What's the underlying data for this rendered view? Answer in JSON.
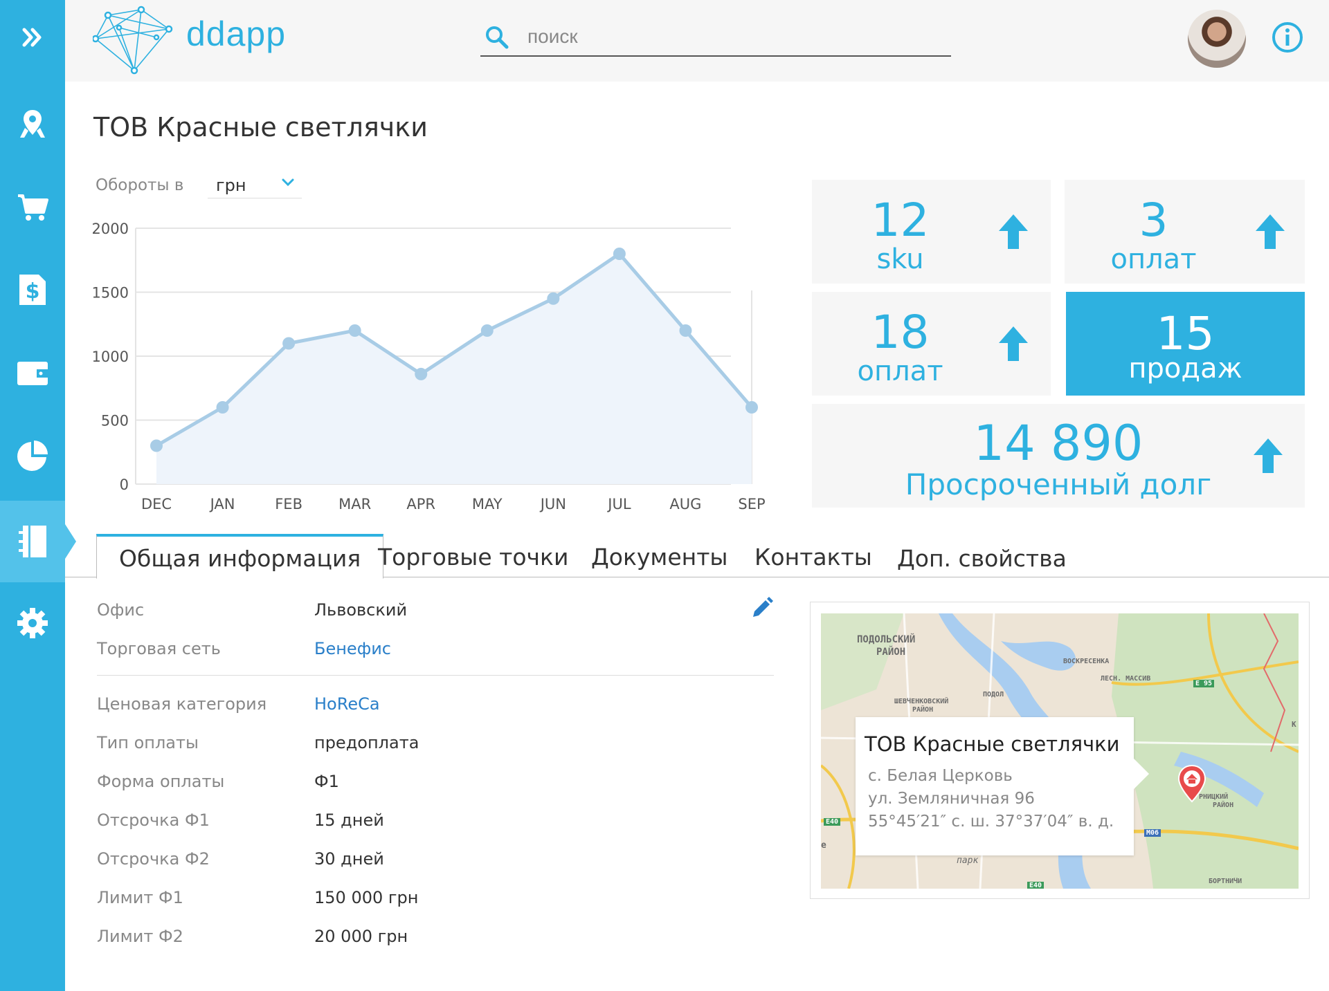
{
  "app": {
    "logo_text": "ddapp"
  },
  "search": {
    "placeholder": "поиск"
  },
  "sidebar": {
    "items": [
      "expand-icon",
      "map-pin-icon",
      "cart-icon",
      "invoice-dollar-icon",
      "wallet-icon",
      "pie-chart-icon",
      "contact-book-icon",
      "gear-icon"
    ],
    "active_index": 6
  },
  "page": {
    "title": "ТОВ Красные светлячки"
  },
  "turnover": {
    "label": "Обороты в",
    "currency": "грн"
  },
  "chart_data": {
    "type": "area",
    "categories": [
      "DEC",
      "JAN",
      "FEB",
      "MAR",
      "APR",
      "MAY",
      "JUN",
      "JUL",
      "AUG",
      "SEP"
    ],
    "values": [
      300,
      600,
      1100,
      1200,
      860,
      1200,
      1450,
      1800,
      1200,
      600
    ],
    "yticks": [
      "0",
      "500",
      "1000",
      "1500",
      "2000"
    ],
    "ylim": [
      0,
      2000
    ],
    "line_color": "#a8cce6",
    "fill_color": "#eef4fb"
  },
  "kpis": {
    "sku": {
      "value": "12",
      "label": "sku"
    },
    "payments_a": {
      "value": "3",
      "label": "оплат"
    },
    "payments_b": {
      "value": "18",
      "label": "оплат"
    },
    "sales": {
      "value": "15",
      "label": "продаж"
    },
    "debt": {
      "value": "14 890",
      "label": "Просроченный долг"
    }
  },
  "tabs": [
    "Общая информация",
    "Торговые точки",
    "Документы",
    "Контакты",
    "Доп. свойства"
  ],
  "details": [
    {
      "key": "Офис",
      "value": "Львовский"
    },
    {
      "key": "Торговая сеть",
      "value": "Бенефис"
    },
    {
      "key": "Ценовая категория",
      "value": "HoReCa"
    },
    {
      "key": "Тип оплаты",
      "value": "предоплата"
    },
    {
      "key": "Форма оплаты",
      "value": "Ф1"
    },
    {
      "key": "Отсрочка Ф1",
      "value": "15 дней"
    },
    {
      "key": "Отсрочка Ф2",
      "value": "30 дней"
    },
    {
      "key": "Лимит Ф1",
      "value": "150 000 грн"
    },
    {
      "key": "Лимит Ф2",
      "value": "20 000 грн"
    }
  ],
  "map": {
    "popup": {
      "title": "ТОВ Красные светлячки",
      "line1": "с. Белая Церковь",
      "line2": "ул. Земляничная 96",
      "line3": "55°45′21″ с. ш. 37°37′04″ в. д."
    },
    "labels": {
      "podolsky": "ПОДОЛЬСКИЙ",
      "rayon": "РАЙОН",
      "voskresenka": "ВОСКРЕСЕНКА",
      "les_massiv": "ЛЕСН. МАССИВ",
      "shevchenkovsky": "ШЕВЧЕНКОВСКИЙ",
      "rayon2": "РАЙОН",
      "podol": "ПОДОЛ",
      "e95": "E 95",
      "e40a": "E40",
      "e40b": "E40",
      "m06": "M06",
      "park": "парк",
      "darnitsky": "РНИЦКИЙ",
      "rayon3": "РАЙОН",
      "bortnichi": "БОРТНИЧИ",
      "k": "К",
      "e": "е"
    }
  },
  "colors": {
    "accent": "#2eb1e0",
    "link": "#2a7fc9"
  }
}
